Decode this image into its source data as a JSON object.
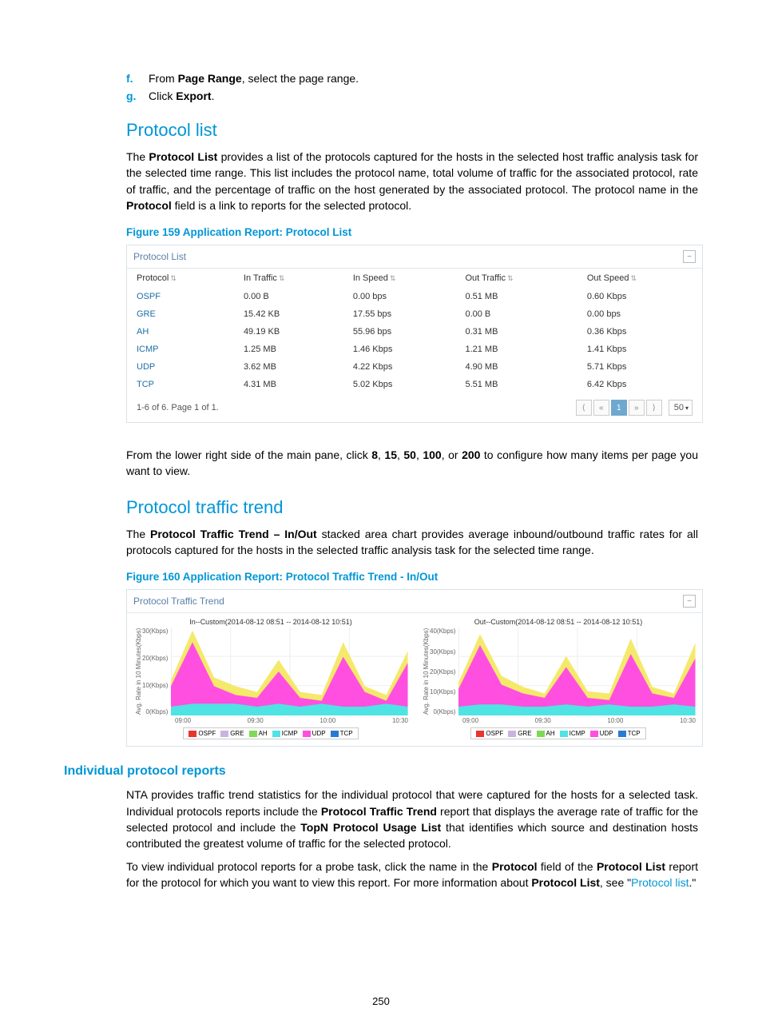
{
  "steps": [
    {
      "marker": "f.",
      "pre": "From ",
      "bold": "Page Range",
      "post": ", select the page range."
    },
    {
      "marker": "g.",
      "pre": "Click ",
      "bold": "Export",
      "post": "."
    }
  ],
  "sec1": {
    "heading": "Protocol list",
    "para": "The <b>Protocol List</b> provides a list of the protocols captured for the hosts in the selected host traffic analysis task for the selected time range. This list includes the protocol name, total volume of traffic for the associated protocol, rate of traffic, and the percentage of traffic on the host generated by the associated protocol. The protocol name in the <b>Protocol</b> field is a link to reports for the selected protocol.",
    "figcap": "Figure 159 Application Report: Protocol List"
  },
  "plist": {
    "title": "Protocol List",
    "headers": [
      "Protocol",
      "In Traffic",
      "In Speed",
      "Out Traffic",
      "Out Speed"
    ],
    "rows": [
      {
        "proto": "OSPF",
        "in_t": "0.00 B",
        "in_s": "0.00 bps",
        "out_t": "0.51 MB",
        "out_s": "0.60 Kbps"
      },
      {
        "proto": "GRE",
        "in_t": "15.42 KB",
        "in_s": "17.55 bps",
        "out_t": "0.00 B",
        "out_s": "0.00 bps"
      },
      {
        "proto": "AH",
        "in_t": "49.19 KB",
        "in_s": "55.96 bps",
        "out_t": "0.31 MB",
        "out_s": "0.36 Kbps"
      },
      {
        "proto": "ICMP",
        "in_t": "1.25 MB",
        "in_s": "1.46 Kbps",
        "out_t": "1.21 MB",
        "out_s": "1.41 Kbps"
      },
      {
        "proto": "UDP",
        "in_t": "3.62 MB",
        "in_s": "4.22 Kbps",
        "out_t": "4.90 MB",
        "out_s": "5.71 Kbps"
      },
      {
        "proto": "TCP",
        "in_t": "4.31 MB",
        "in_s": "5.02 Kbps",
        "out_t": "5.51 MB",
        "out_s": "6.42 Kbps"
      }
    ],
    "footer": "1-6 of 6. Page 1 of 1.",
    "pager": {
      "current": "1",
      "size": "50"
    }
  },
  "midpara": "From the lower right side of the main pane, click <b>8</b>, <b>15</b>, <b>50</b>, <b>100</b>, or <b>200</b> to configure how many items per page you want to view.",
  "sec2": {
    "heading": "Protocol traffic trend",
    "para": "The <b>Protocol Traffic Trend – In/Out</b> stacked area chart provides average inbound/outbound traffic rates for all protocols captured for the hosts in the selected traffic analysis task for the selected time range.",
    "figcap": "Figure 160 Application Report: Protocol Traffic Trend - In/Out"
  },
  "trend": {
    "title": "Protocol Traffic Trend",
    "left_title": "In--Custom(2014-08-12 08:51 -- 2014-08-12 10:51)",
    "right_title": "Out--Custom(2014-08-12 08:51 -- 2014-08-12 10:51)",
    "ylabel": "Avg. Rate in 10 Minutes(Kbps)",
    "left_y": [
      "30(Kbps)",
      "20(Kbps)",
      "10(Kbps)",
      "0(Kbps)"
    ],
    "right_y": [
      "40(Kbps)",
      "30(Kbps)",
      "20(Kbps)",
      "10(Kbps)",
      "0(Kbps)"
    ],
    "x": [
      "09:00",
      "09:30",
      "10:00",
      "10:30"
    ],
    "legend": [
      "OSPF",
      "GRE",
      "AH",
      "ICMP",
      "UDP",
      "TCP"
    ],
    "colors": {
      "OSPF": "#e8352e",
      "GRE": "#c9b3e0",
      "AH": "#7ed957",
      "ICMP": "#4fe3e3",
      "UDP": "#ff4fe0",
      "TCP": "#2a7ad2"
    }
  },
  "chart_data": [
    {
      "type": "area",
      "title": "In--Custom(2014-08-12 08:51 -- 2014-08-12 10:51)",
      "xlabel": "",
      "ylabel": "Avg. Rate in 10 Minutes(Kbps)",
      "ylim": [
        0,
        30
      ],
      "x": [
        "09:00",
        "09:10",
        "09:20",
        "09:30",
        "09:40",
        "09:50",
        "10:00",
        "10:10",
        "10:20",
        "10:30",
        "10:40",
        "10:50"
      ],
      "series": [
        {
          "name": "ICMP",
          "values": [
            3,
            4,
            4,
            4,
            3,
            4,
            3,
            4,
            3,
            3,
            4,
            3
          ]
        },
        {
          "name": "UDP",
          "values": [
            10,
            25,
            10,
            7,
            6,
            15,
            6,
            5,
            20,
            8,
            5,
            18
          ]
        },
        {
          "name": "TCP",
          "values": [
            12,
            29,
            13,
            10,
            8,
            19,
            8,
            7,
            25,
            10,
            7,
            22
          ]
        }
      ]
    },
    {
      "type": "area",
      "title": "Out--Custom(2014-08-12 08:51 -- 2014-08-12 10:51)",
      "xlabel": "",
      "ylabel": "Avg. Rate in 10 Minutes(Kbps)",
      "ylim": [
        0,
        40
      ],
      "x": [
        "09:00",
        "09:10",
        "09:20",
        "09:30",
        "09:40",
        "09:50",
        "10:00",
        "10:10",
        "10:20",
        "10:30",
        "10:40",
        "10:50"
      ],
      "series": [
        {
          "name": "ICMP",
          "values": [
            4,
            5,
            5,
            4,
            4,
            5,
            4,
            5,
            4,
            4,
            5,
            4
          ]
        },
        {
          "name": "UDP",
          "values": [
            12,
            32,
            14,
            10,
            8,
            22,
            8,
            7,
            28,
            10,
            8,
            26
          ]
        },
        {
          "name": "TCP",
          "values": [
            15,
            37,
            18,
            13,
            10,
            27,
            11,
            10,
            35,
            13,
            10,
            33
          ]
        }
      ]
    }
  ],
  "sec3": {
    "heading": "Individual protocol reports",
    "p1": "NTA provides traffic trend statistics for the individual protocol that were captured for the hosts for a selected task. Individual protocols reports include the <b>Protocol Traffic Trend</b> report that displays the average rate of traffic for the selected protocol and include the <b>TopN Protocol Usage List</b> that identifies which source and destination hosts contributed the greatest volume of traffic for the selected protocol.",
    "p2_pre": "To view individual protocol reports for a probe task, click the name in the <b>Protocol</b> field of the <b>Protocol List</b> report for the protocol for which you want to view this report. For more information about <b>Protocol List</b>, see \"",
    "p2_link": "Protocol list",
    "p2_post": ".\""
  },
  "pagenum": "250"
}
